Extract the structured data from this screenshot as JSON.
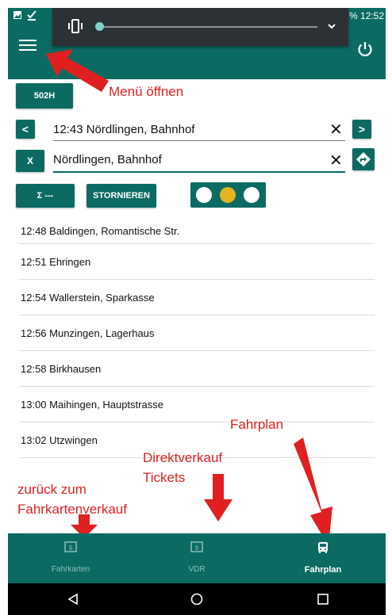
{
  "status_bar": {
    "battery_text": "%",
    "time": "12:52"
  },
  "toolbar": {
    "menu_icon": "hamburger-icon",
    "power_icon": "power-icon"
  },
  "volume_panel": {
    "mode_icon": "vibrate-icon",
    "expand_icon": "chevron-down-icon"
  },
  "controls": {
    "line_button": "502H",
    "prev_button": "<",
    "next_button": ">",
    "stop_field_value": "12:43 Nördlingen, Bahnhof",
    "cancel_x_button": "X",
    "dest_field_value": "Nördlingen, Bahnhof",
    "clear_symbol": "✕",
    "sum_button": "Σ ---",
    "storno_button": "STORNIEREN",
    "traffic_light_colors": [
      "#ffffff",
      "#e6b21d",
      "#ffffff"
    ]
  },
  "stops": [
    "12:48 Baldingen, Romantische Str.",
    "12:51 Ehringen",
    "12:54 Wallerstein, Sparkasse",
    "12:56 Munzingen, Lagerhaus",
    "12:58 Birkhausen",
    "13:00 Maihingen, Hauptstrasse",
    "13:02 Utzwingen"
  ],
  "annotations": {
    "menu": "Menü öffnen",
    "fahrplan": "Fahrplan",
    "direkt_line1": "Direktverkauf",
    "direkt_line2": "Tickets",
    "zurueck_line1": "zurück zum",
    "zurueck_line2": "Fahrkartenverkauf",
    "color": "#e02020"
  },
  "bottom_nav": [
    {
      "label": "Fahrkarten",
      "icon": "ticket-icon"
    },
    {
      "label": "VDR",
      "icon": "ticket-icon"
    },
    {
      "label": "Fahrplan",
      "icon": "bus-icon"
    }
  ],
  "system_nav": {
    "back": "back-icon",
    "home": "home-icon",
    "recents": "recents-icon"
  },
  "colors": {
    "primary": "#0b6b63",
    "accent": "#e6b21d",
    "annotation": "#e02020"
  }
}
